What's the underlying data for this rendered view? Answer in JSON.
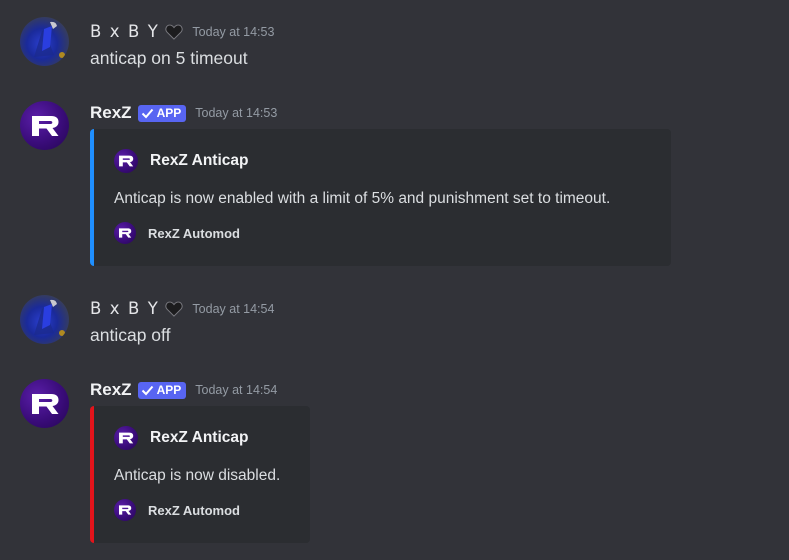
{
  "messages": [
    {
      "author": "B x B Y",
      "author_emoji": "black-heart-icon",
      "timestamp": "Today at 14:53",
      "content": "anticap on 5 timeout"
    },
    {
      "author": "RexZ",
      "badge": "APP",
      "timestamp": "Today at 14:53",
      "embed": {
        "color": "#1f8fff",
        "author_name": "RexZ Anticap",
        "description": "Anticap is now enabled with a limit of 5% and punishment set to timeout.",
        "footer": "RexZ Automod"
      }
    },
    {
      "author": "B x B Y",
      "author_emoji": "black-heart-icon",
      "timestamp": "Today at 14:54",
      "content": "anticap off"
    },
    {
      "author": "RexZ",
      "badge": "APP",
      "timestamp": "Today at 14:54",
      "embed": {
        "color": "#e3141b",
        "author_name": "RexZ Anticap",
        "description": "Anticap is now disabled.",
        "footer": "RexZ Automod"
      }
    }
  ],
  "colors": {
    "background": "#323339",
    "embed_background": "#2b2d31",
    "app_badge": "#5865f2",
    "timestamp": "#949ba4"
  }
}
